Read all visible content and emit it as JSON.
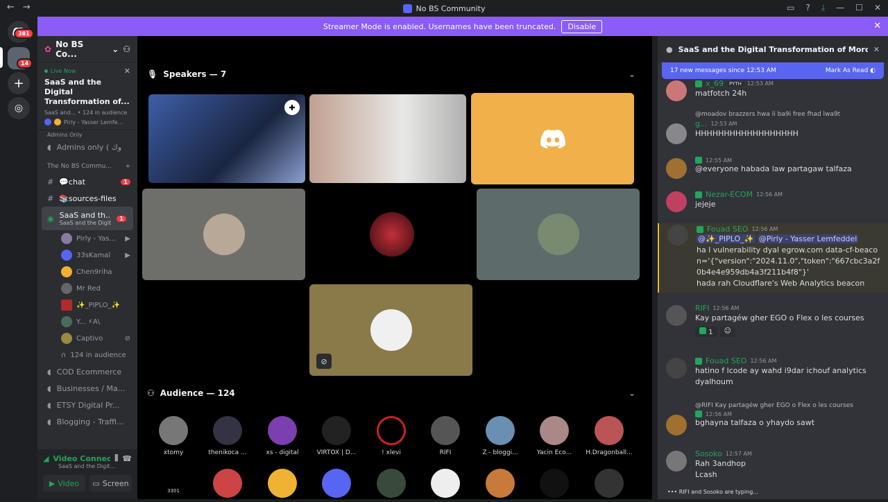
{
  "window": {
    "title": "No BS Community"
  },
  "banner": {
    "text": "Streamer Mode is enabled. Usernames have been truncated.",
    "button": "Disable"
  },
  "guilds": {
    "home_badge": "381",
    "server_badge": "14"
  },
  "sidebar": {
    "server_name": "No BS Co...",
    "live": {
      "label": "Live Now",
      "title": "SaaS and the Digital Transformation of...",
      "meta": "SaaS and... • 124 in audience",
      "host": "Pirly - Yasser Lemfe..."
    },
    "admins_cat": "Admins Only",
    "admins_chan": "Admins only ( وك",
    "category": "The No BS Commu...",
    "channels": [
      {
        "name": "💬chat",
        "badge": "1"
      },
      {
        "name": "📚sources-files"
      },
      {
        "name": "SaaS and th...",
        "sub": "SaaS and the Digital Tr...",
        "badge": "1"
      }
    ],
    "members": [
      "Pirly - Yas...",
      "33sKamal",
      "Chen9riha",
      "Mr Red",
      "✨_PIPLO_✨",
      "Y... ⚡A\\",
      "Captivo"
    ],
    "audience_count": "124 in audience",
    "more_channels": [
      "COD Ecommerce",
      "Businesses / Ma...",
      "ETSY Digital Pr...",
      "Blogging - Traffi..."
    ],
    "voice": {
      "status": "Video Connected",
      "channel": "SaaS and the Digit...",
      "video": "Video",
      "screen": "Screen"
    }
  },
  "stage": {
    "speakers": "Speakers — 7",
    "audience": "Audience — 124"
  },
  "audience": [
    {
      "name": "xtomy",
      "color": "#777"
    },
    {
      "name": "thenikoca ...",
      "color": "#334"
    },
    {
      "name": "xs - digital",
      "color": "#7b3fb0"
    },
    {
      "name": "VIRTOX | D...",
      "color": "#222"
    },
    {
      "name": "! xlevi",
      "color": "#000"
    },
    {
      "name": "RIFI",
      "color": "#555"
    },
    {
      "name": "Z - bloggi...",
      "color": "#6b8fb0"
    },
    {
      "name": "Yacin Eco...",
      "color": "#a88"
    },
    {
      "name": "H.Dragonball...",
      "color": "#b55"
    }
  ],
  "audience_row2": [
    "3301"
  ],
  "chat": {
    "header": "SaaS and the Digital Transformation of Moroccan In",
    "newbar": "17 new messages since 12:53 AM",
    "mark": "Mark As Read",
    "messages": [
      {
        "author": "x_69",
        "tag": "PYTH",
        "time": "12:53 AM",
        "text": "matfotch 24h",
        "color": "#23a55a"
      },
      {
        "reply": "@moadov brazzers hwa li ba9i free fhad lwa9t",
        "author": "g...",
        "time": "12:53 AM",
        "text": "HHHHHHHHHHHHHHHHHH",
        "color": "#23a55a"
      },
      {
        "author": "",
        "time": "12:55 AM",
        "text": "@everyone habada law partagaw talfaza",
        "color": "#23a55a"
      },
      {
        "author": "Nezar-ECOM",
        "time": "12:56 AM",
        "text": "jejeje",
        "color": "#23a55a"
      },
      {
        "author": "Fouad SEO",
        "time": "12:56 AM",
        "text1": "@✨_PIPLO_✨",
        "text2": "@Pirly - Yasser Lemfeddel",
        "text3": "ha l vulnerability dyal egrow.com data-cf-beacon='{\"version\":\"2024.11.0\",\"token\":\"667cbc3a2f0b4e4e959db4a3f211b4f8\"}'",
        "text4": "hada rah Cloudflare's Web Analytics beacon",
        "color": "#23a55a"
      },
      {
        "author": "RIFI",
        "time": "12:56 AM",
        "text": "Kay partagéw gher EGO o Flex o les courses",
        "reaction": "1",
        "color": "#23a55a"
      },
      {
        "author": "Fouad SEO",
        "time": "12:56 AM",
        "text": "hatino f lcode ay wahd i9dar ichouf analytics dyalhoum",
        "color": "#23a55a"
      },
      {
        "reply": "@RIFI Kay partagéw gher EGO o Flex o les courses",
        "author": "",
        "time": "12:56 AM",
        "text": "bghayna talfaza o yhaydo sawt",
        "color": "#23a55a"
      },
      {
        "author": "Sosoko",
        "time": "12:57 AM",
        "text": "Rah 3andhop",
        "text2": "Lcash",
        "color": "#23a55a"
      }
    ],
    "typing": "RIFI and Sosoko are typing..."
  }
}
